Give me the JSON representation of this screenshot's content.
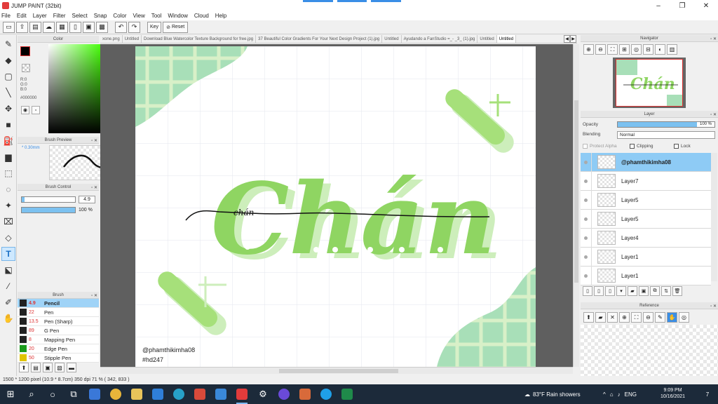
{
  "window": {
    "title": "JUMP PAINT (32bit)",
    "controls": [
      "–",
      "❐",
      "✕"
    ]
  },
  "menu": [
    "File",
    "Edit",
    "Layer",
    "Filter",
    "Select",
    "Snap",
    "Color",
    "View",
    "Tool",
    "Window",
    "Cloud",
    "Help"
  ],
  "toolbar": {
    "key_label": "Key",
    "reset_label": "Reset"
  },
  "color_panel": {
    "title": "Color",
    "rgb_text": [
      "R:0",
      "G:0",
      "B:0"
    ],
    "hex": "#000000",
    "fg_color": "#000000"
  },
  "brush_preview": {
    "title": "Brush Preview",
    "size": "* 0.30mm"
  },
  "brush_control": {
    "title": "Brush Control",
    "size_value": "4.9",
    "opacity_value": "100 %",
    "size_level": 0.05,
    "opacity_level": 1.0
  },
  "brush_panel": {
    "title": "Brush",
    "items": [
      {
        "num": "4.9",
        "name": "Pencil",
        "color": "#222222",
        "active": true
      },
      {
        "num": "22",
        "name": "Pen",
        "color": "#222222"
      },
      {
        "num": "13.5",
        "name": "Pen (Sharp)",
        "color": "#222222"
      },
      {
        "num": "89",
        "name": "G Pen",
        "color": "#222222"
      },
      {
        "num": "8",
        "name": "Mapping Pen",
        "color": "#222222"
      },
      {
        "num": "20",
        "name": "Edge Pen",
        "color": "#1a9a1a"
      },
      {
        "num": "50",
        "name": "Stipple Pen",
        "color": "#e0c400"
      }
    ]
  },
  "tabs": [
    "xone.png",
    "Untitled",
    "Download Blue Watercolor Texture Background for free.jpg",
    "37 Beautiful Color Gradients For Your Next Design Project (1).jpg",
    "Untitled",
    "Ayudando a FanStudio =_- _3_ (1).jpg",
    "Untitled",
    "Untitled"
  ],
  "canvas": {
    "lettering": "Chán",
    "handwriting": "chán",
    "credit": "@phamthikimha08",
    "hashtag": "#hd247",
    "green_light": "#a6e07a",
    "green_mid": "#8fd562",
    "green_pale": "#cdeebb",
    "tile_green": "#a8dfb8"
  },
  "navigator": {
    "title": "Navigator"
  },
  "layer_panel": {
    "title": "Layer",
    "opacity_label": "Opacity",
    "opacity_value": "100 %",
    "blending_label": "Blending",
    "blending_value": "Normal",
    "protect_alpha": "Protect Alpha",
    "clipping": "Clipping",
    "lock": "Lock",
    "layers": [
      {
        "name": "@phamthikimha08",
        "active": true
      },
      {
        "name": "Layer7"
      },
      {
        "name": "Layer5"
      },
      {
        "name": "Layer5"
      },
      {
        "name": "Layer4"
      },
      {
        "name": "Layer1"
      },
      {
        "name": "Layer1"
      }
    ]
  },
  "reference": {
    "title": "Reference"
  },
  "status": "1500 * 1200 pixel   (10.9 * 8.7cm)   350 dpi   71 %   ( 342, 833 )",
  "taskbar": {
    "weather": "83°F  Rain showers",
    "lang": "ENG",
    "time": "9:09 PM",
    "date": "10/16/2021",
    "notif": "7"
  }
}
